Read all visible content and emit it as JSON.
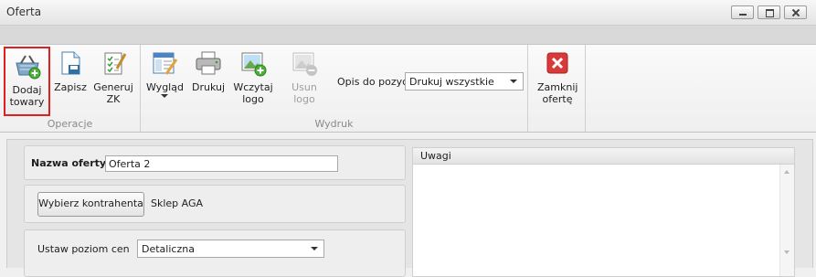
{
  "window": {
    "title": "Oferta"
  },
  "ribbon": {
    "groups": {
      "operacje": "Operacje",
      "wydruk": "Wydruk"
    },
    "buttons": {
      "dodaj_line1": "Dodaj",
      "dodaj_line2": "towary",
      "zapisz": "Zapisz",
      "generuj_line1": "Generuj",
      "generuj_line2": "ZK",
      "wyglad": "Wygląd",
      "drukuj": "Drukuj",
      "wczytaj_line1": "Wczytaj",
      "wczytaj_line2": "logo",
      "usun_logo": "Usun logo",
      "zamknij_line1": "Zamknij",
      "zamknij_line2": "ofertę"
    },
    "opis_label": "Opis do pozycji",
    "opis_value": "Drukuj wszystkie",
    "icons": [
      "basket-add-icon",
      "save-icon",
      "checklist-icon",
      "layout-pencil-icon",
      "printer-icon",
      "image-add-icon",
      "image-remove-icon",
      "close-red-icon"
    ]
  },
  "form": {
    "nazwa_label": "Nazwa oferty",
    "nazwa_value": "Oferta 2",
    "wybierz_button": "Wybierz kontrahenta",
    "kontrahent_value": "Sklep AGA",
    "poziom_label": "Ustaw poziom cen",
    "poziom_value": "Detaliczna",
    "uwagi_label": "Uwagi"
  },
  "colors": {
    "highlight": "#e02020",
    "close_icon": "#d83a3a"
  }
}
